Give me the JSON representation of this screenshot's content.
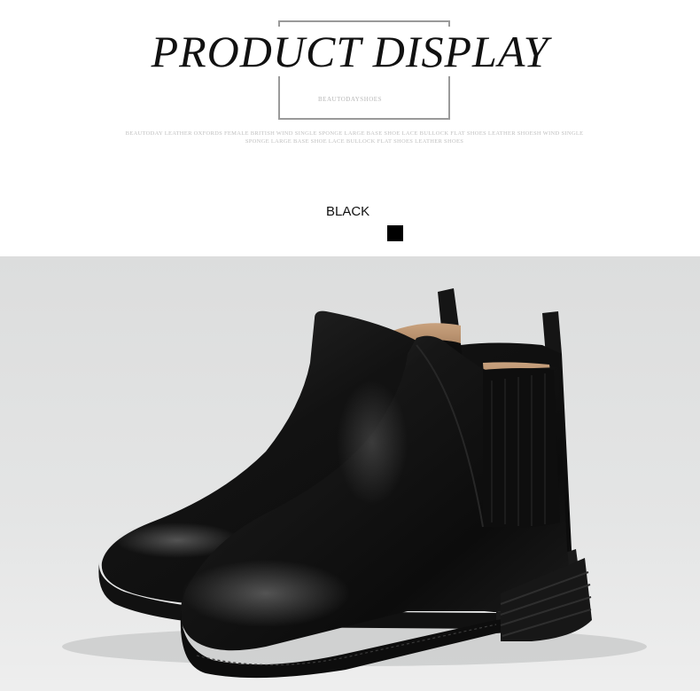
{
  "header": {
    "title": "PRODUCT DISPLAY",
    "brand": "BEAUTODAYSHOES",
    "description_line1": "BEAUTODAY LEATHER OXFORDS FEMALE BRITISH WIND SINGLE SPONGE LARGE BASE SHOE LACE BULLOCK FLAT SHOES LEATHER SHOESH WIND SINGLE",
    "description_line2": "SPONGE LARGE BASE SHOE LACE BULLOCK FLAT SHOES LEATHER SHOES"
  },
  "color_option": {
    "label": "BLACK",
    "swatch_color": "#000000"
  },
  "product_image": {
    "subject": "black leather chelsea boots",
    "background_color": "#e0e1e1"
  }
}
